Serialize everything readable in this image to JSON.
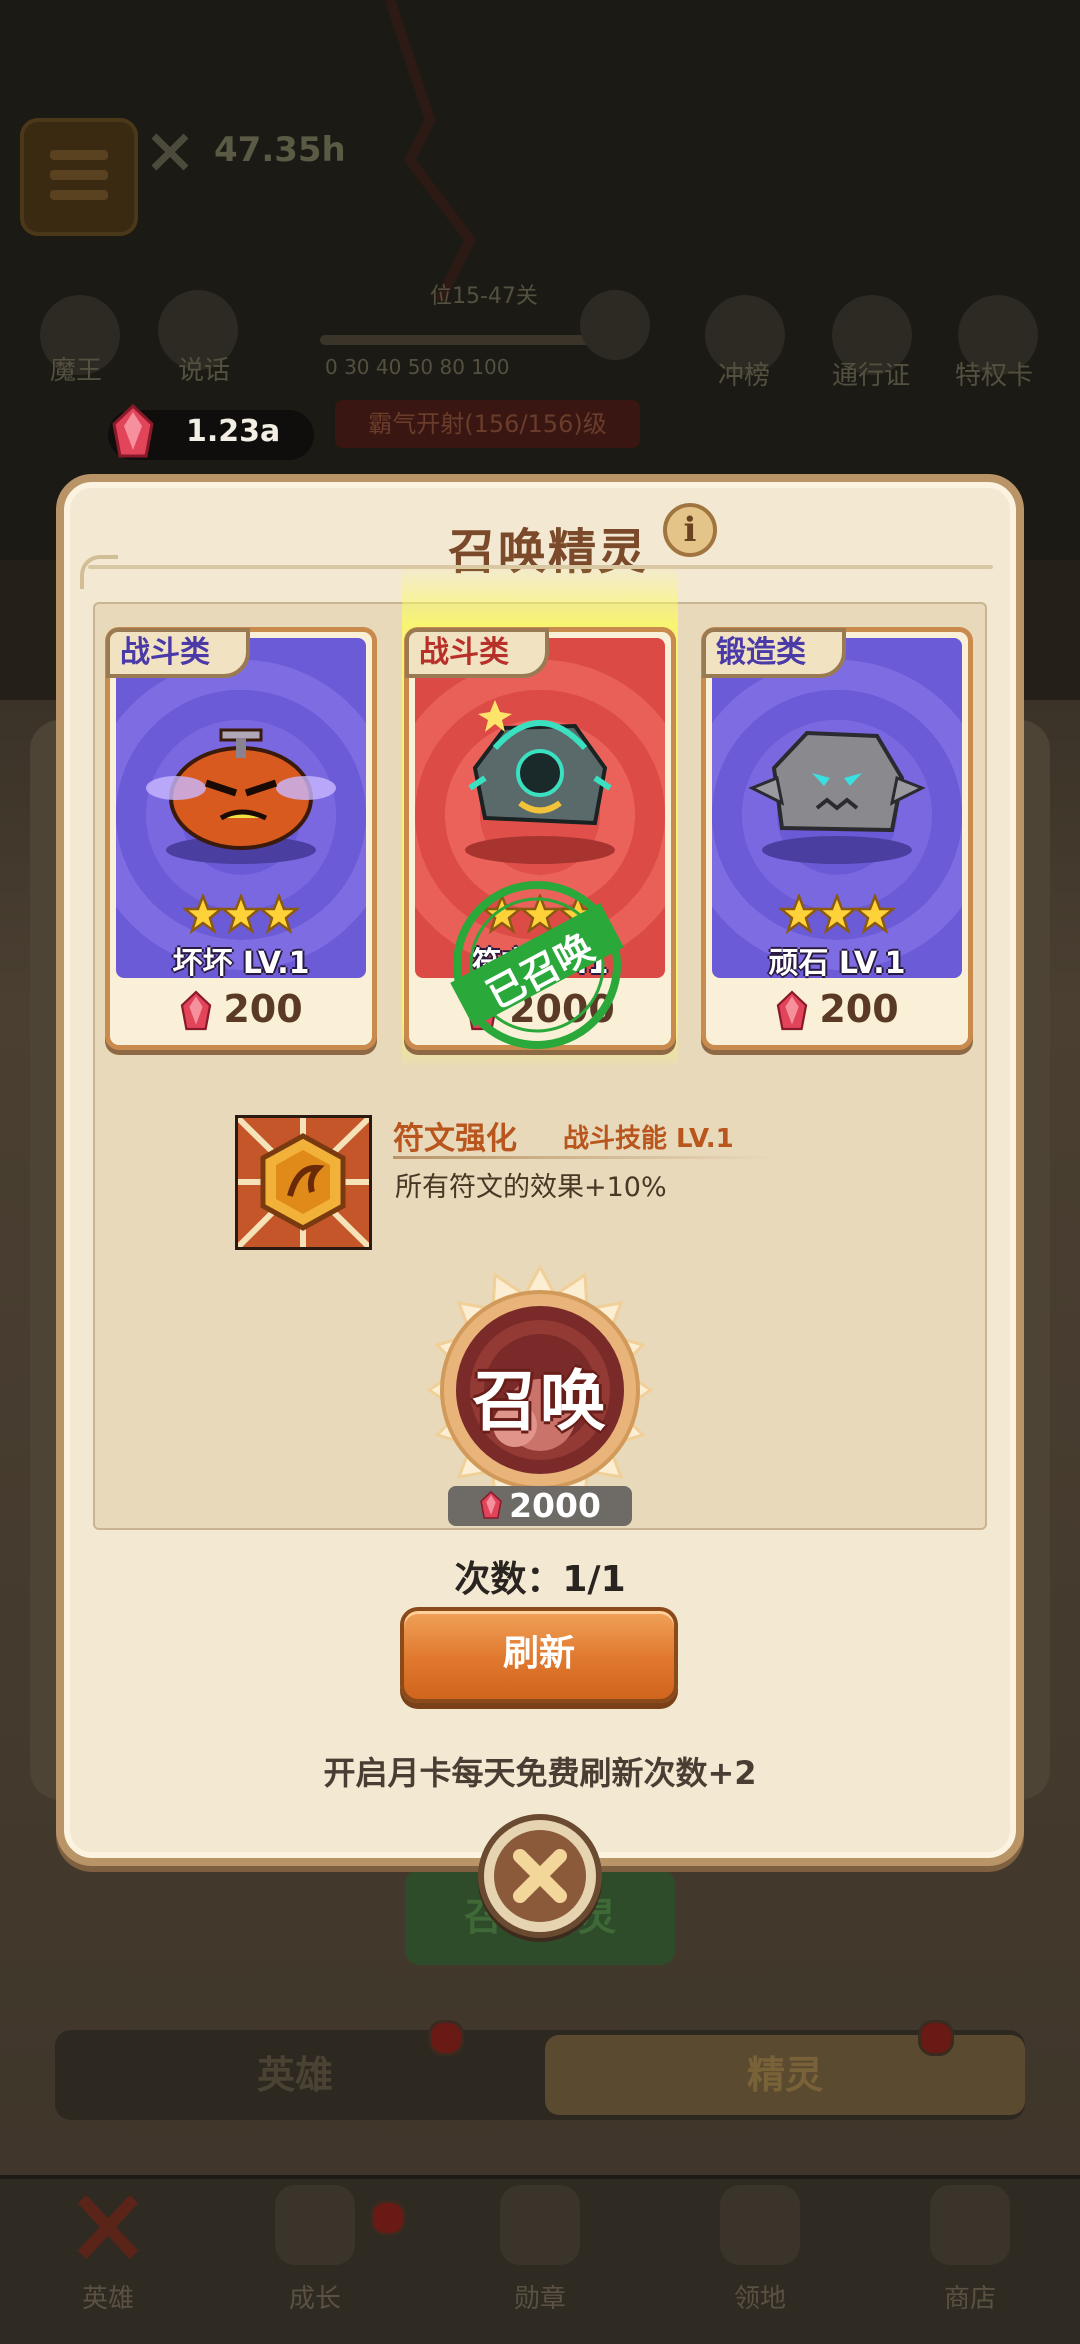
{
  "background": {
    "power_value": "47.35h",
    "gem_balance": "1.23a",
    "event_banner": "霸气开射(156/156)级",
    "slider_label": "位15-47关",
    "slider_ticks": "0  30  40  50  80  100",
    "left_icons": [
      "魔王",
      "说话"
    ],
    "right_icons": [
      "冲榜",
      "通行证",
      "特权卡"
    ],
    "summon_button": "召唤精灵",
    "tabs": [
      "英雄",
      "精灵"
    ],
    "nav": [
      "英雄",
      "成长",
      "勋章",
      "领地",
      "商店"
    ]
  },
  "modal": {
    "title": "召唤精灵",
    "info_label": "i",
    "cards": [
      {
        "category": "战斗类",
        "name": "坏坏 LV.1",
        "price": "200",
        "theme": "purple",
        "stars": 3
      },
      {
        "category": "战斗类",
        "name": "符文 LV.1",
        "price": "2000",
        "theme": "red",
        "stars": 3,
        "stamp": "已召唤"
      },
      {
        "category": "锻造类",
        "name": "顽石 LV.1",
        "price": "200",
        "theme": "purple",
        "stars": 3
      }
    ],
    "skill": {
      "name": "符文强化",
      "level": "战斗技能 LV.1",
      "description": "所有符文的效果+10%"
    },
    "summon": {
      "label": "召唤",
      "cost": "2000"
    },
    "count_text": "次数：1/1",
    "refresh_label": "刷新",
    "monthly_card_text": "开启月卡每天免费刷新次数+2"
  },
  "colors": {
    "modal_bg": "#f3e9d2",
    "purple_card": "#6c5bd6",
    "red_card": "#e04f4a",
    "refresh_orange": "#e0782e",
    "gem_red": "#e2455a"
  },
  "icons": [
    "menu-icon",
    "sword-icon",
    "gem-icon",
    "info-icon",
    "star-icon",
    "summon-seal-icon",
    "close-x-icon",
    "rune-skill-icon"
  ]
}
